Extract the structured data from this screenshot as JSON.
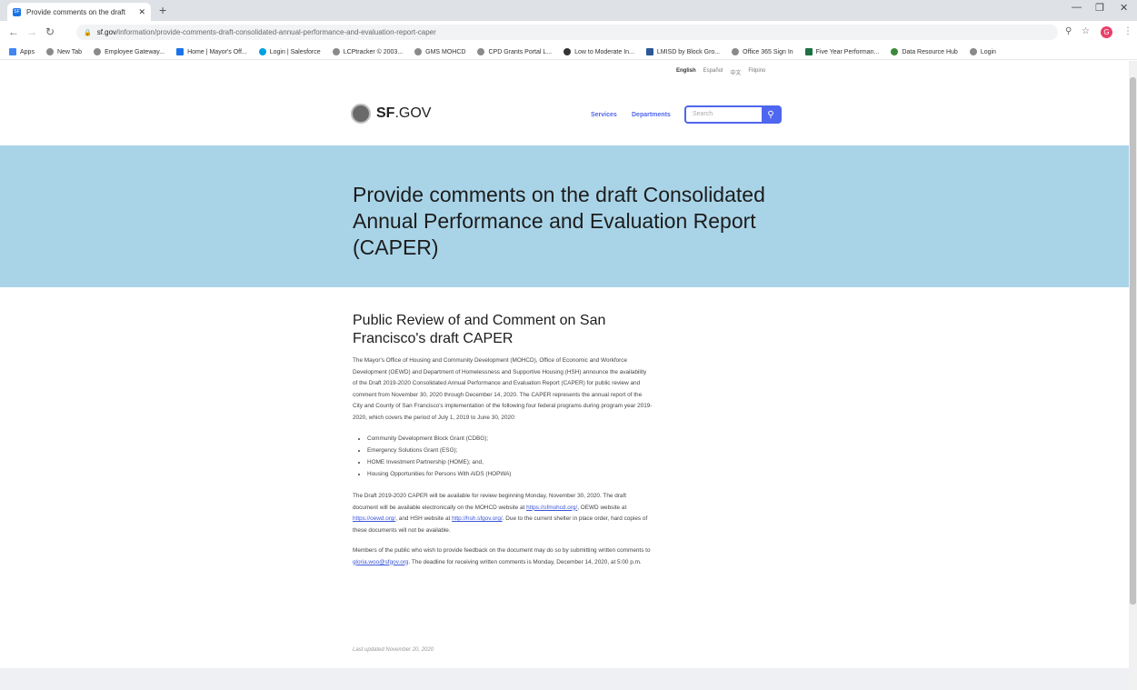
{
  "browser": {
    "tab_title": "Provide comments on the draft",
    "url_domain": "sf.gov",
    "url_path": "/information/provide-comments-draft-consolidated-annual-performance-and-evaluation-report-caper",
    "bookmarks": [
      "Apps",
      "New Tab",
      "Employee Gateway...",
      "Home | Mayor's Off...",
      "Login | Salesforce",
      "LCPtracker © 2003...",
      "GMS MOHCD",
      "CPD Grants Portal L...",
      "Low to Moderate In...",
      "LMISD by Block Gro...",
      "Office 365 Sign In",
      "Five Year Performan...",
      "Data Resource Hub",
      "Login"
    ],
    "profile_initial": "G"
  },
  "site": {
    "languages": [
      "English",
      "Español",
      "中文",
      "Filipino"
    ],
    "logo_bold": "SF",
    "logo_rest": ".GOV",
    "nav_services": "Services",
    "nav_departments": "Departments",
    "search_placeholder": "Search"
  },
  "hero": {
    "title": "Provide comments on the draft Consolidated Annual Performance and Evaluation Report (CAPER)"
  },
  "content": {
    "heading": "Public Review of and Comment on San Francisco's draft CAPER",
    "intro": "The Mayor's Office of Housing and Community Development (MOHCD), Office of Economic and Workforce Development (OEWD) and Department of Homelessness and Supportive Housing (HSH) announce the availability of the Draft 2019-2020 Consolidated Annual Performance and Evaluation Report (CAPER) for public review and comment from November 30, 2020 through December 14, 2020. The CAPER represents the annual report of the City and County of San Francisco's implementation of the following four federal programs during program year 2019-2020, which covers the period of July 1, 2019 to June 30, 2020:",
    "programs": [
      "Community Development Block Grant (CDBG);",
      "Emergency Solutions Grant (ESG);",
      "HOME Investment Partnership (HOME); and,",
      "Housing Opportunities for Persons With AIDS (HOPWA)"
    ],
    "p2_a": "The Draft 2019-2020 CAPER will be available for review beginning Monday, November 30, 2020. The draft document will be available electronically on the MOHCD website at ",
    "link_mohcd": "https://sfmohcd.org/",
    "p2_b": ", OEWD website at ",
    "link_oewd": "https://oewd.org/",
    "p2_c": ", and HSH website at ",
    "link_hsh": "http://hsh.sfgov.org/",
    "p2_d": ". Due to the current shelter in place order, hard copies of these documents will not be available.",
    "p3_a": "Members of the public who wish to provide feedback on the document may do so by submitting written comments to ",
    "link_email": "gloria.woo@sfgov.org",
    "p3_b": ". The deadline for receiving written comments is Monday, December 14, 2020, at 5:00 p.m.",
    "last_updated": "Last updated November 20, 2020"
  }
}
